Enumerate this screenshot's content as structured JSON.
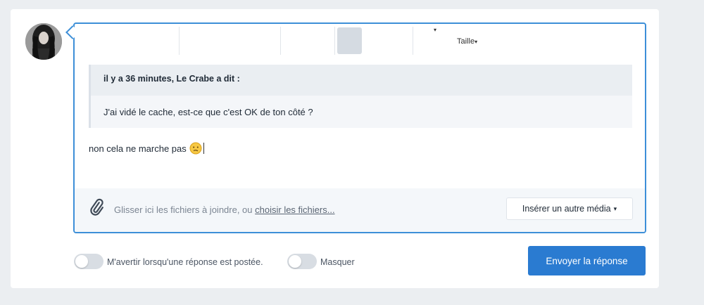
{
  "toolbar": {
    "size_label": "Taille",
    "caret_glyph": "▾"
  },
  "quote": {
    "header": "il y a 36 minutes, Le Crabe a dit :",
    "text": "J'ai vidé le cache, est-ce que c'est OK de ton côté ?"
  },
  "reply": {
    "text": "non cela ne marche pas",
    "emoji": "confused-face-icon"
  },
  "attachments": {
    "prompt": "Glisser ici les fichiers à joindre, ou ",
    "link": "choisir les fichiers...",
    "media_button": "Insérer un autre média",
    "media_caret": "▾"
  },
  "options": {
    "notify_label": "M'avertir lorsqu'une réponse est postée.",
    "notify_on": false,
    "hide_label": "Masquer",
    "hide_on": false
  },
  "submit_label": "Envoyer la réponse",
  "colors": {
    "accent": "#2a7bd1",
    "editor_border": "#3d8fd8",
    "page_bg": "#ebeef1"
  }
}
